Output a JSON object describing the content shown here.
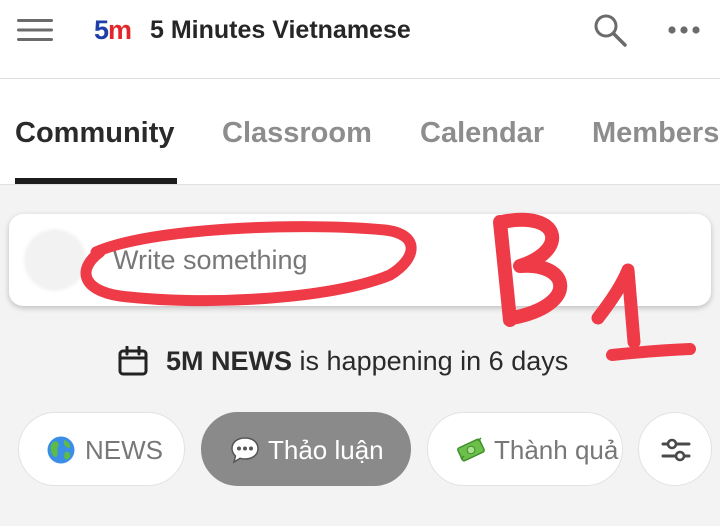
{
  "header": {
    "logo_digit": "5",
    "logo_letter": "m",
    "title": "5 Minutes Vietnamese",
    "icons": [
      "hamburger-menu-icon",
      "search-icon",
      "more-horizontal-icon"
    ]
  },
  "tabs": [
    {
      "label": "Community",
      "active": true
    },
    {
      "label": "Classroom",
      "active": false
    },
    {
      "label": "Calendar",
      "active": false
    },
    {
      "label": "Members",
      "active": false
    }
  ],
  "composer": {
    "placeholder": "Write something"
  },
  "event": {
    "name": "5M NEWS",
    "suffix": "is happening in 6 days",
    "icon": "calendar-icon"
  },
  "chips": [
    {
      "label": "NEWS",
      "icon": "globe-emoji",
      "active": false
    },
    {
      "label": "Thảo luận",
      "icon": "speech-bubble-emoji",
      "active": true
    },
    {
      "label": "Thành quả",
      "icon": "money-emoji",
      "active": false
    },
    {
      "icon": "filter-sliders-icon"
    }
  ],
  "handwriting": {
    "text": "B1",
    "color": "#ee3b47"
  },
  "colors": {
    "logo_blue": "#1f3ea8",
    "logo_red": "#e3262a",
    "active_chip": "#8a8a8a",
    "annotation_red": "#ee3b47"
  }
}
